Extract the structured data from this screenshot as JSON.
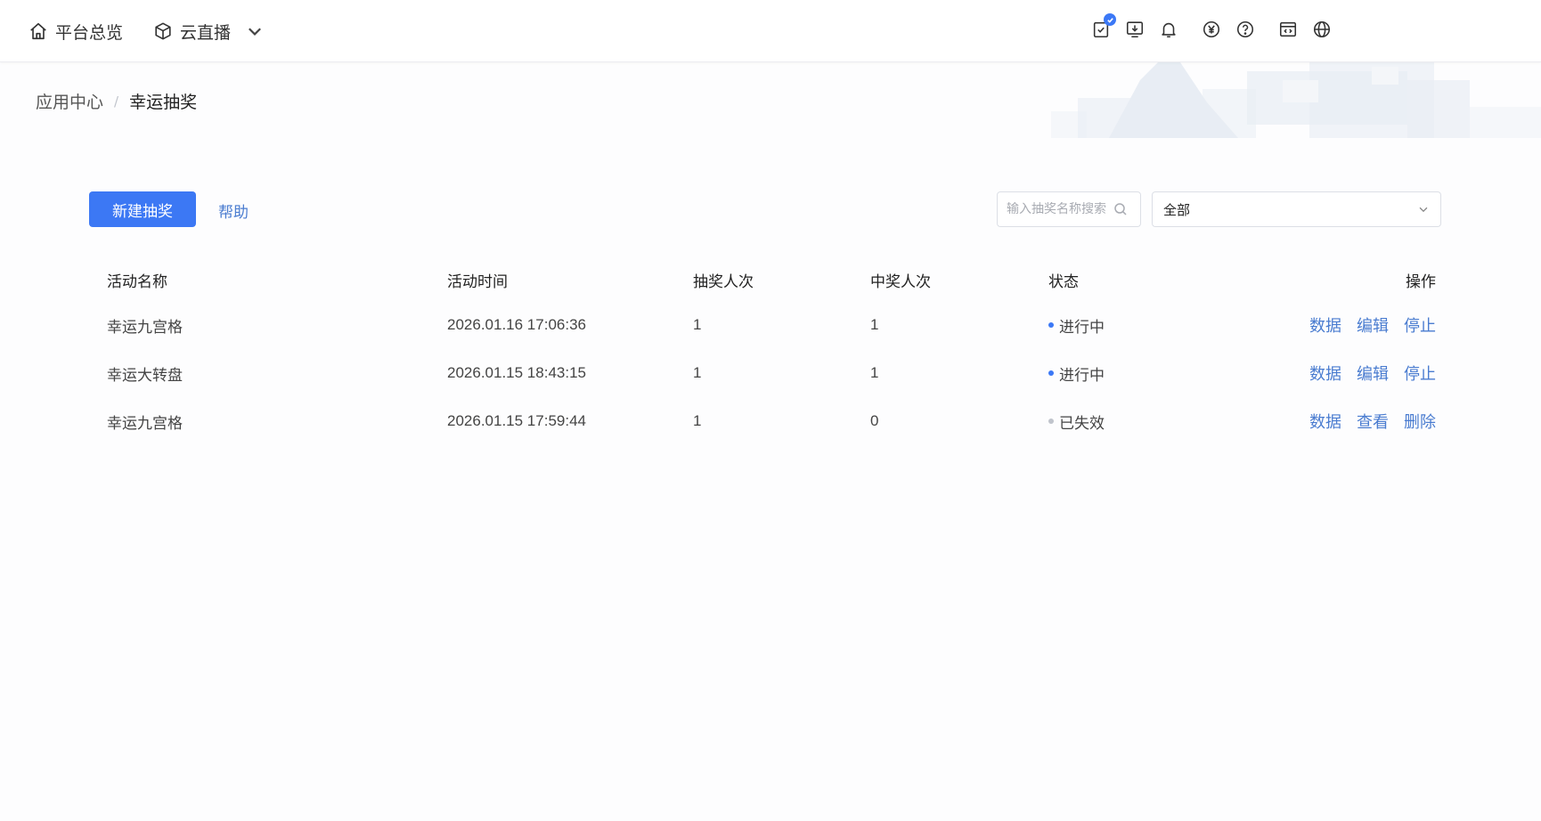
{
  "header": {
    "nav_home": "平台总览",
    "nav_live": "云直播",
    "tool_icons": [
      "tasks-icon",
      "download-icon",
      "bell-icon",
      "yuan-icon",
      "help-icon",
      "code-window-icon",
      "globe-icon"
    ]
  },
  "breadcrumb": {
    "root": "应用中心",
    "separator": "/",
    "current": "幸运抽奖"
  },
  "toolbar": {
    "new_button": "新建抽奖",
    "help_link": "帮助",
    "search_placeholder": "输入抽奖名称搜索",
    "filter_value": "全部"
  },
  "table": {
    "headers": {
      "name": "活动名称",
      "time": "活动时间",
      "draws": "抽奖人次",
      "wins": "中奖人次",
      "status": "状态",
      "ops": "操作"
    },
    "rows": [
      {
        "name": "幸运九宫格",
        "time": "2026.01.16 17:06:36",
        "draws": "1",
        "wins": "1",
        "status": "进行中",
        "status_color": "#3b78f6",
        "ops": [
          "数据",
          "编辑",
          "停止"
        ]
      },
      {
        "name": "幸运大转盘",
        "time": "2026.01.15 18:43:15",
        "draws": "1",
        "wins": "1",
        "status": "进行中",
        "status_color": "#3b78f6",
        "ops": [
          "数据",
          "编辑",
          "停止"
        ]
      },
      {
        "name": "幸运九宫格",
        "time": "2026.01.15 17:59:44",
        "draws": "1",
        "wins": "0",
        "status": "已失效",
        "status_color": "#c0c4cc",
        "ops": [
          "数据",
          "查看",
          "删除"
        ]
      }
    ]
  },
  "colors": {
    "primary": "#3c78f4",
    "link": "#4a7cd0",
    "active_dot": "#3b78f6",
    "inactive_dot": "#c0c4cc"
  }
}
